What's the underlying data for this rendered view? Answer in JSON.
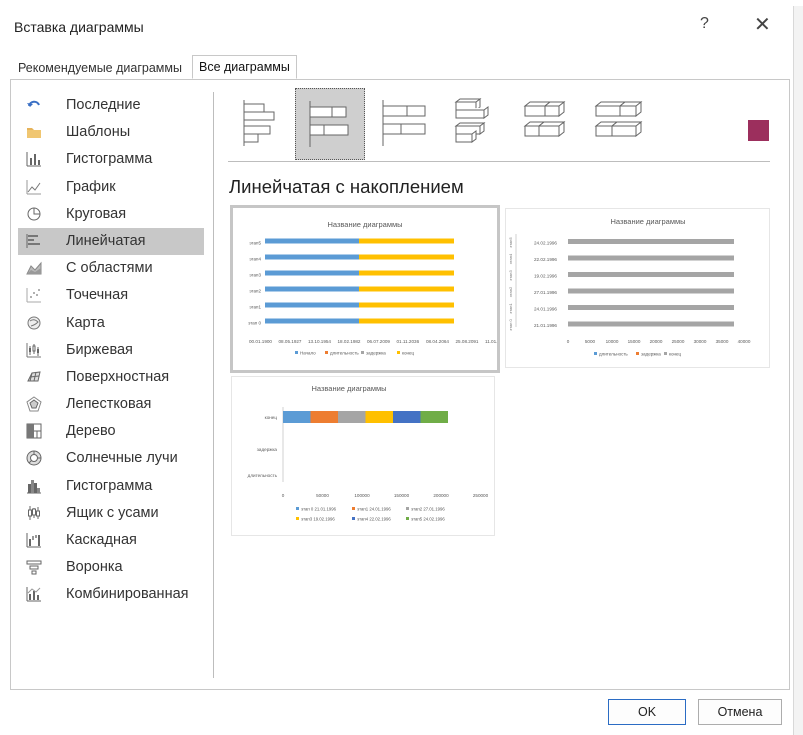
{
  "dialog": {
    "title": "Вставка диаграммы",
    "help_label": "?",
    "close_label": "✕"
  },
  "tabs": [
    {
      "label": "Рекомендуемые диаграммы",
      "active": false
    },
    {
      "label": "Все диаграммы",
      "active": true
    }
  ],
  "sidebar": {
    "items": [
      {
        "label": "Последние",
        "icon": "recent-icon",
        "active": false
      },
      {
        "label": "Шаблоны",
        "icon": "folder-icon",
        "active": false
      },
      {
        "label": "Гистограмма",
        "icon": "column-chart-icon",
        "active": false
      },
      {
        "label": "График",
        "icon": "line-chart-icon",
        "active": false
      },
      {
        "label": "Круговая",
        "icon": "pie-chart-icon",
        "active": false
      },
      {
        "label": "Линейчатая",
        "icon": "bar-chart-icon",
        "active": true
      },
      {
        "label": "С областями",
        "icon": "area-chart-icon",
        "active": false
      },
      {
        "label": "Точечная",
        "icon": "scatter-chart-icon",
        "active": false
      },
      {
        "label": "Карта",
        "icon": "map-chart-icon",
        "active": false
      },
      {
        "label": "Биржевая",
        "icon": "stock-chart-icon",
        "active": false
      },
      {
        "label": "Поверхностная",
        "icon": "surface-chart-icon",
        "active": false
      },
      {
        "label": "Лепестковая",
        "icon": "radar-chart-icon",
        "active": false
      },
      {
        "label": "Дерево",
        "icon": "treemap-chart-icon",
        "active": false
      },
      {
        "label": "Солнечные лучи",
        "icon": "sunburst-chart-icon",
        "active": false
      },
      {
        "label": "Гистограмма",
        "icon": "histogram-chart-icon",
        "active": false
      },
      {
        "label": "Ящик с усами",
        "icon": "box-whisker-chart-icon",
        "active": false
      },
      {
        "label": "Каскадная",
        "icon": "waterfall-chart-icon",
        "active": false
      },
      {
        "label": "Воронка",
        "icon": "funnel-chart-icon",
        "active": false
      },
      {
        "label": "Комбинированная",
        "icon": "combo-chart-icon",
        "active": false
      }
    ]
  },
  "subtypes": {
    "items": [
      "clustered-bar-icon",
      "stacked-bar-icon",
      "100-stacked-bar-icon",
      "3d-clustered-bar-icon",
      "3d-stacked-bar-icon",
      "3d-100-stacked-bar-icon"
    ],
    "selected_index": 1,
    "accent_color": "#9c2f5d"
  },
  "selected_heading": "Линейчатая с накоплением",
  "colors": {
    "blue": "#5b9bd5",
    "orange": "#ed7d31",
    "gray": "#a5a5a5",
    "yellow": "#ffc000",
    "darkblue": "#4472c4",
    "green": "#70ad47"
  },
  "previews": [
    {
      "title": "Название диаграммы",
      "categories": [
        "этап 0",
        "этап1",
        "этап2",
        "этап3",
        "этап4",
        "этап5"
      ],
      "x_ticks": [
        "00.01.1900",
        "08.05.1927",
        "13.10.1954",
        "18.02.1982",
        "06.07.2009",
        "01.11.2036",
        "08.04.2064",
        "25.08.2091",
        "11.01.2119"
      ],
      "legend": [
        "Начало",
        "длительность",
        "задержка",
        "конец"
      ]
    },
    {
      "title": "Название диаграммы",
      "categories": [
        "21.01.1996",
        "24.01.1996",
        "27.01.1996",
        "19.02.1996",
        "22.02.1996",
        "24.02.1996"
      ],
      "side_labels": [
        "этап 0",
        "этап1",
        "этап2",
        "этап3",
        "этап4",
        "этап5"
      ],
      "x_ticks": [
        "0",
        "5000",
        "10000",
        "15000",
        "20000",
        "25000",
        "30000",
        "35000",
        "40000"
      ],
      "legend": [
        "длительность",
        "задержка",
        "конец"
      ]
    },
    {
      "title": "Название диаграммы",
      "categories": [
        "длительность",
        "задержка",
        "конец"
      ],
      "x_ticks": [
        "0",
        "50000",
        "100000",
        "150000",
        "200000",
        "250000"
      ],
      "legend_row1": [
        "этап 0 21.01.1996",
        "этап1 24.01.1996",
        "этап2 27.01.1996"
      ],
      "legend_row2": [
        "этап3 19.02.1996",
        "этап4 22.02.1996",
        "этап5 24.02.1996"
      ]
    }
  ],
  "buttons": {
    "ok": "OK",
    "cancel": "Отмена"
  }
}
